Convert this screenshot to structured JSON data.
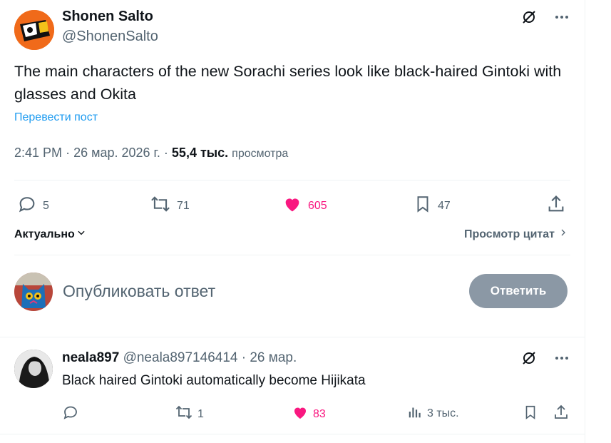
{
  "post": {
    "display_name": "Shonen Salto",
    "handle": "@ShonenSalto",
    "text": "The main characters of the new Sorachi series look like black-haired Gintoki with glasses and Okita",
    "translate_label": "Перевести пост",
    "time": "2:41 PM",
    "date": "26 мар. 2026 г.",
    "views_count": "55,4 тыс.",
    "views_label": "просмотра",
    "replies": "5",
    "reposts": "71",
    "likes": "605",
    "bookmarks": "47"
  },
  "sort": {
    "left_label": "Актуально",
    "right_label": "Просмотр цитат"
  },
  "compose": {
    "placeholder": "Опубликовать ответ",
    "button_label": "Ответить"
  },
  "reply": {
    "display_name": "neala897",
    "handle": "@neala897146414",
    "date": "26 мар.",
    "text": "Black haired Gintoki automatically become Hijikata",
    "reposts": "1",
    "likes": "83",
    "views": "3 тыс."
  },
  "colors": {
    "accent": "#1d9bf0",
    "like": "#f91880",
    "muted": "#536471",
    "button_disabled": "#8b98a5"
  },
  "icons": {
    "grok": "grok-icon",
    "more": "more-icon",
    "reply": "reply-icon",
    "repost": "repost-icon",
    "like": "heart-icon",
    "bookmark": "bookmark-icon",
    "share": "share-icon",
    "views": "views-icon"
  }
}
